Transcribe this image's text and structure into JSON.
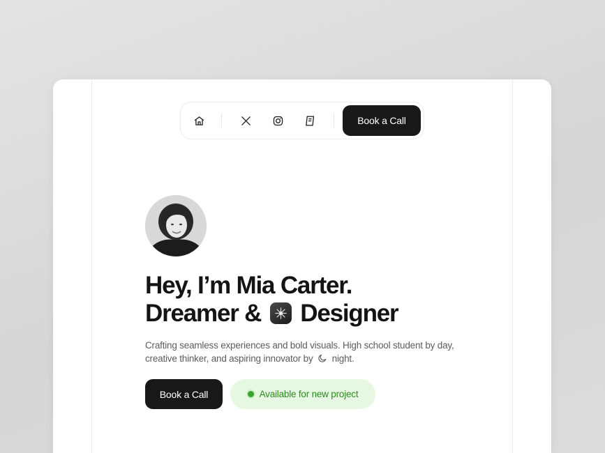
{
  "nav": {
    "icons": [
      "home-icon",
      "x-logo-icon",
      "instagram-icon",
      "notes-icon"
    ],
    "book_label": "Book a Call"
  },
  "hero": {
    "line1": "Hey, I’m Mia Carter.",
    "line2_pre": "Dreamer &",
    "line2_post": "Designer",
    "bio_pre": "Crafting seamless experiences and bold visuals. High school student by day, creative thinker, and aspiring innovator by",
    "bio_post": "night.",
    "cta_label": "Book a Call",
    "status_label": "Available for new project"
  },
  "colors": {
    "accent_dark": "#181818",
    "status_bg": "#e6f8e2",
    "status_text": "#2e8a22"
  }
}
